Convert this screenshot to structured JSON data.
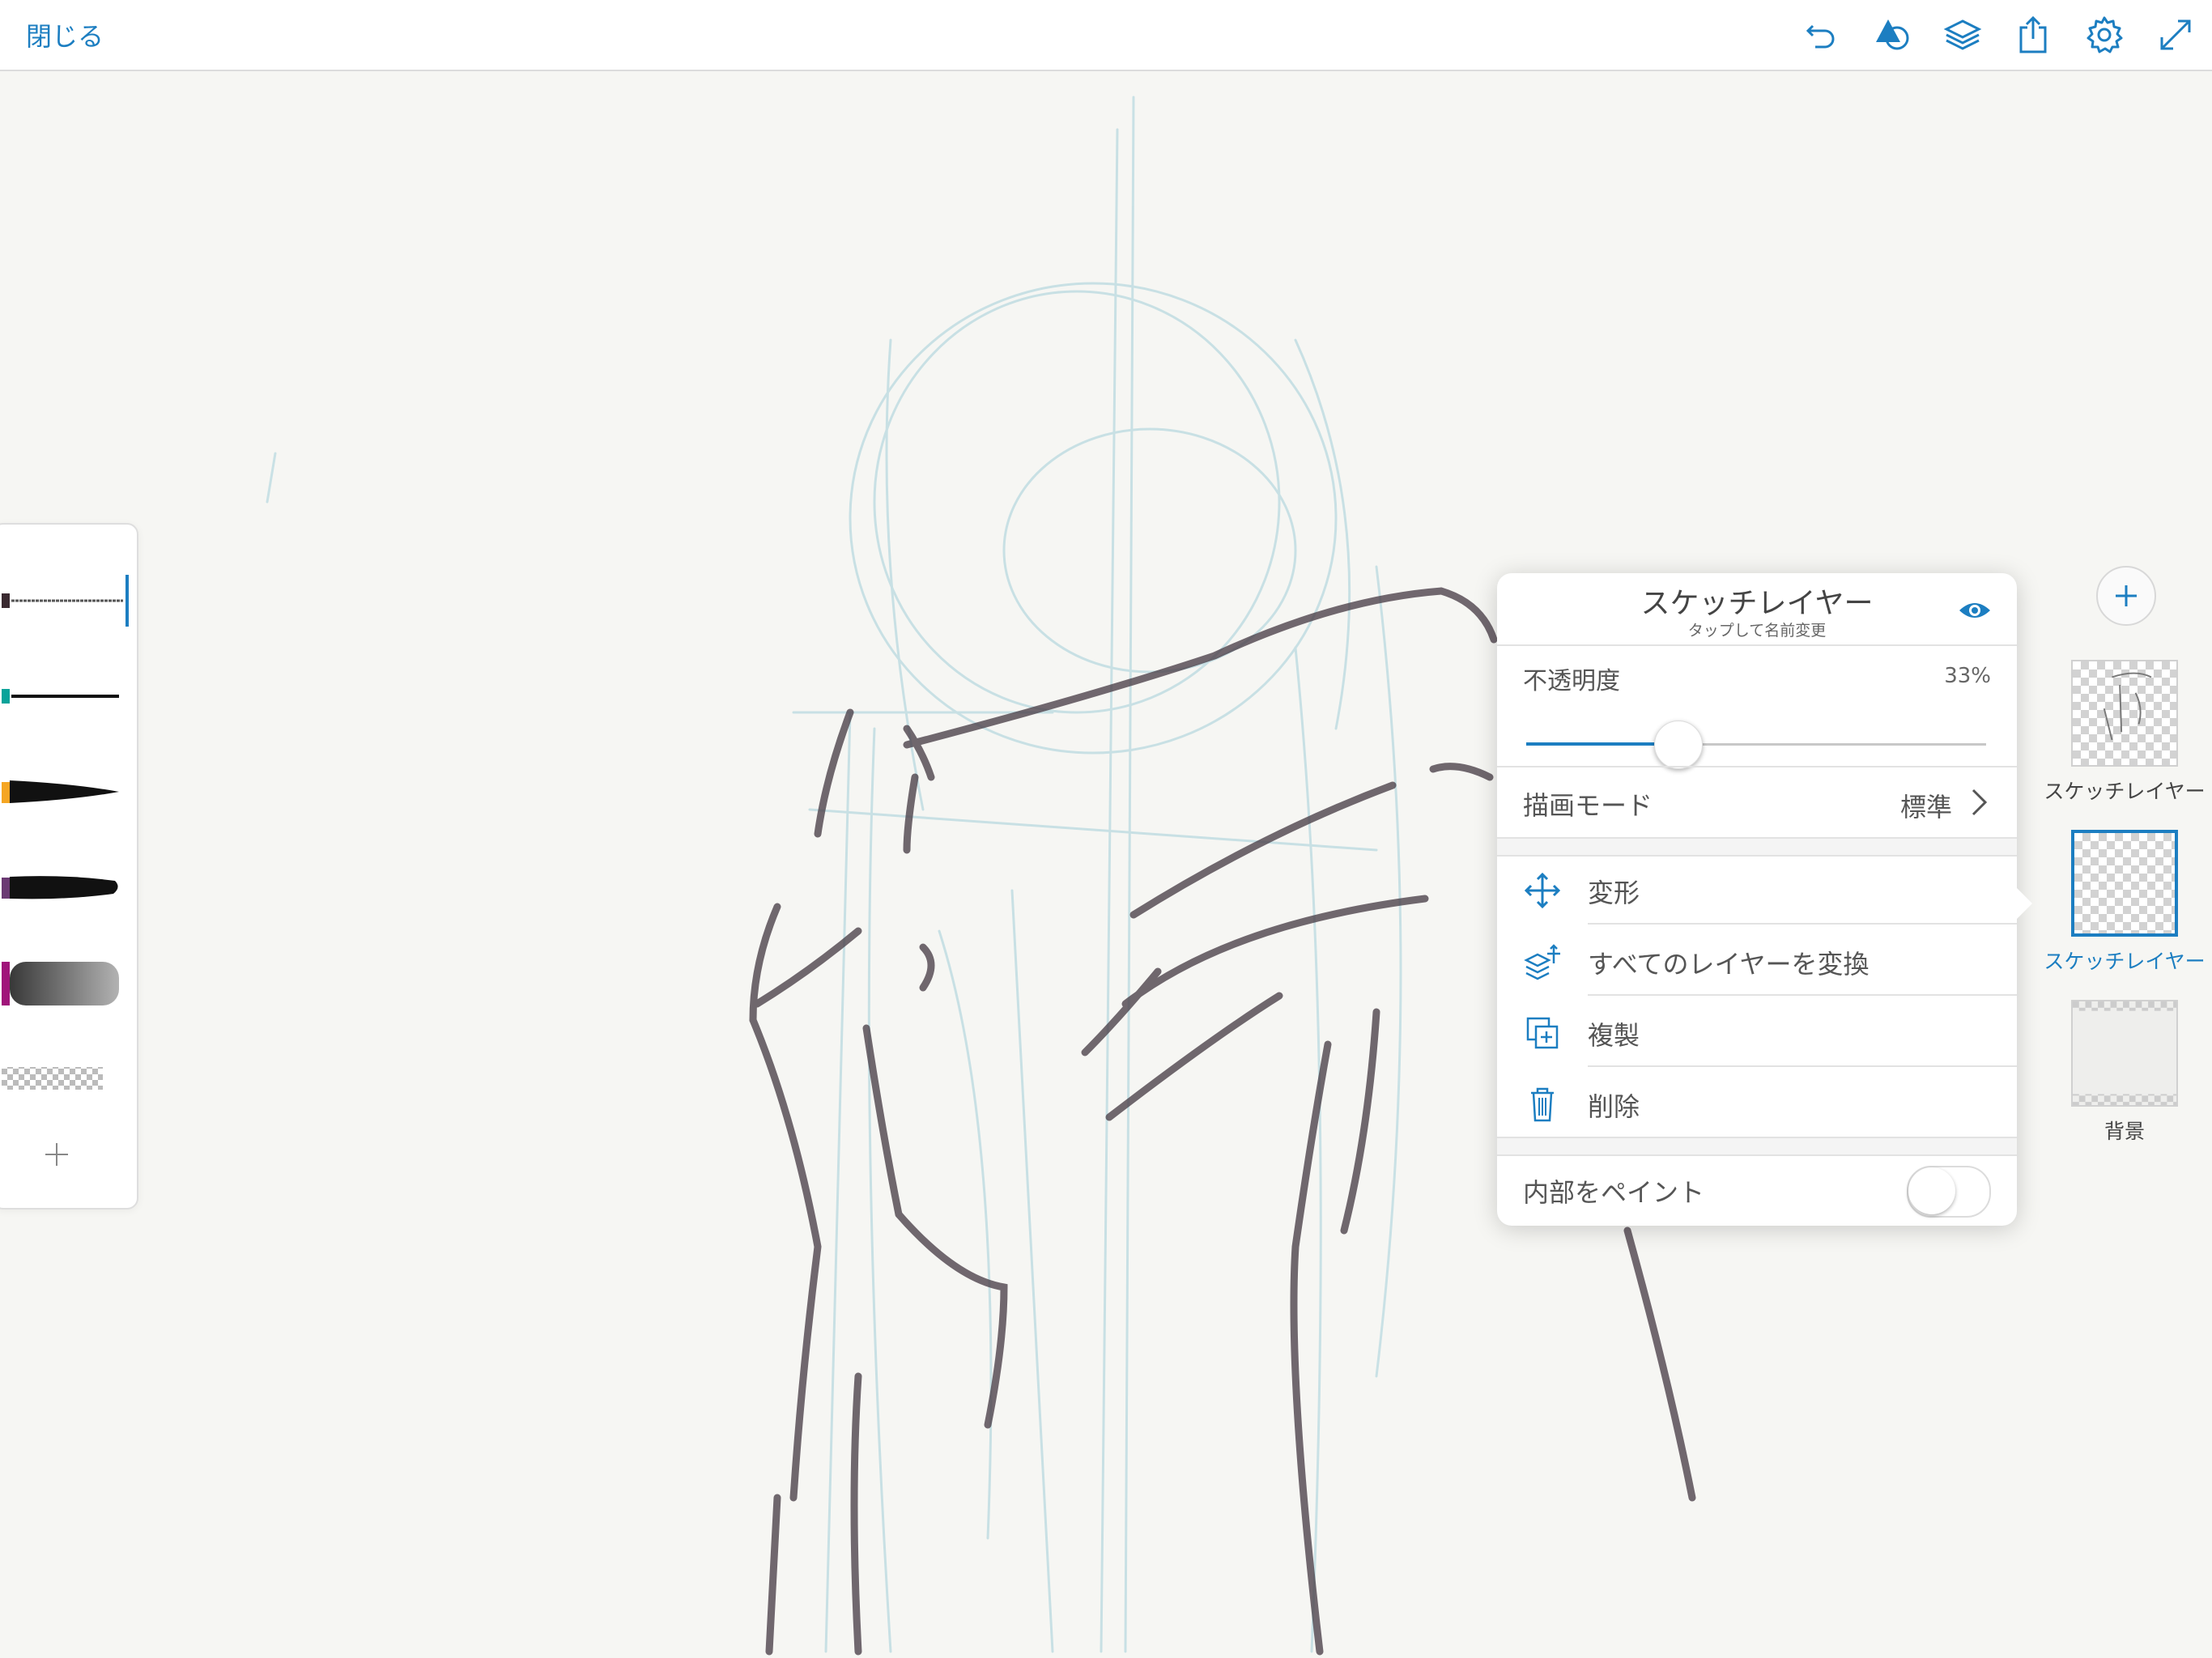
{
  "top_bar": {
    "close_label": "閉じる",
    "icons": [
      "undo-icon",
      "shapes-icon",
      "layers-icon",
      "share-icon",
      "settings-icon",
      "fullscreen-icon"
    ]
  },
  "brush_panel": {
    "brushes": [
      {
        "name": "pencil",
        "color": "#3a2a30",
        "selected": true
      },
      {
        "name": "ink-pen",
        "color": "#0aa39a",
        "selected": false
      },
      {
        "name": "tapered-brush",
        "color": "#f5a623",
        "selected": false
      },
      {
        "name": "dry-brush",
        "color": "#6b3a73",
        "selected": false
      },
      {
        "name": "soft-brush",
        "color": "#a0157a",
        "selected": false
      },
      {
        "name": "eraser",
        "color": "#cccccc",
        "selected": false
      }
    ]
  },
  "layer_popover": {
    "title": "スケッチレイヤー",
    "subtitle": "タップして名前変更",
    "opacity_label": "不透明度",
    "opacity_value": "33%",
    "opacity": 0.33,
    "blend_mode_label": "描画モード",
    "blend_mode_value": "標準",
    "actions": [
      {
        "label": "変形",
        "icon": "move-icon"
      },
      {
        "label": "すべてのレイヤーを変換",
        "icon": "transform-all-layers-icon"
      },
      {
        "label": "複製",
        "icon": "duplicate-icon"
      },
      {
        "label": "削除",
        "icon": "trash-icon"
      }
    ],
    "paint_inside_label": "内部をペイント",
    "paint_inside_on": false
  },
  "layers": [
    {
      "label": "スケッチレイヤー",
      "selected": false
    },
    {
      "label": "スケッチレイヤー",
      "selected": true
    },
    {
      "label": "背景",
      "selected": false
    }
  ],
  "colors": {
    "accent": "#1c7ec1",
    "canvas": "#f6f6f3"
  }
}
